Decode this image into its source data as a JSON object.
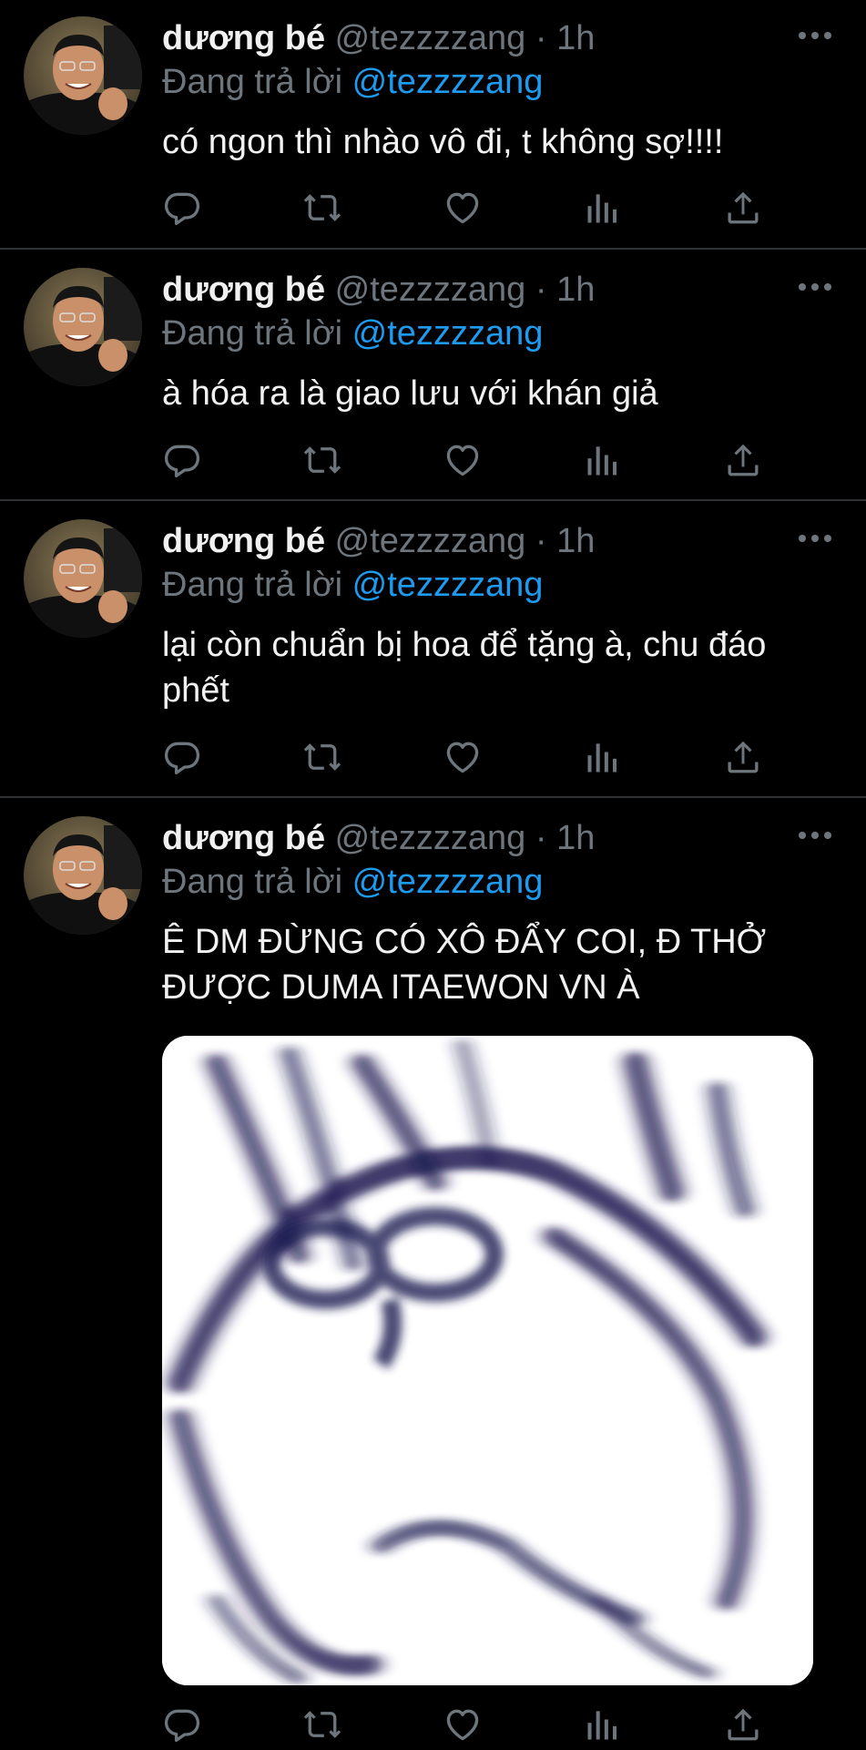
{
  "tweets": [
    {
      "name": "dương bé",
      "handle": "@tezzzzang",
      "dot": "·",
      "time": "1h",
      "replying_prefix": "Đang trả lời ",
      "replying_to": "@tezzzzang",
      "text": "có ngon thì nhào vô đi, t không sợ!!!!"
    },
    {
      "name": "dương bé",
      "handle": "@tezzzzang",
      "dot": "·",
      "time": "1h",
      "replying_prefix": "Đang trả lời ",
      "replying_to": "@tezzzzang",
      "text": "à hóa ra là giao lưu với khán giả"
    },
    {
      "name": "dương bé",
      "handle": "@tezzzzang",
      "dot": "·",
      "time": "1h",
      "replying_prefix": "Đang trả lời ",
      "replying_to": "@tezzzzang",
      "text_line1": "lại còn chuẩn bị hoa để tặng à, chu đáo",
      "text_line2": "phết"
    },
    {
      "name": "dương bé",
      "handle": "@tezzzzang",
      "dot": "·",
      "time": "1h",
      "replying_prefix": "Đang trả lời ",
      "replying_to": "@tezzzzang",
      "text_line1": "Ê DM ĐỪNG CÓ XÔ ĐẨY COI, Đ THỞ",
      "text_line2": "ĐƯỢC DUMA ITAEWON VN À",
      "has_media": true
    }
  ],
  "icons": {
    "reply": "reply-icon",
    "retweet": "retweet-icon",
    "like": "heart-icon",
    "views": "analytics-icon",
    "share": "share-icon",
    "more": "more-icon"
  },
  "colors": {
    "background": "#000000",
    "text": "#f1f1f1",
    "muted": "#6e767d",
    "link": "#1d9bf0",
    "divider": "#2f3336"
  }
}
